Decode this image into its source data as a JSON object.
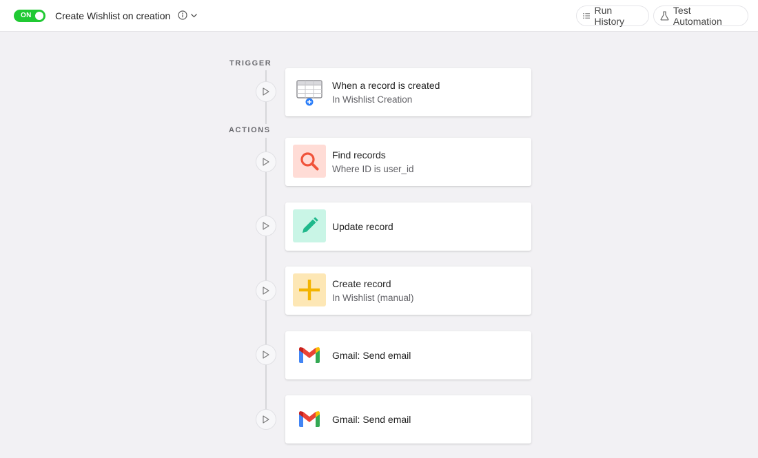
{
  "header": {
    "toggle_label": "ON",
    "title": "Create Wishlist on creation",
    "run_history_label": "Run History",
    "test_automation_label": "Test Automation",
    "toggle_color": "#20c933"
  },
  "sections": {
    "trigger_label": "TRIGGER",
    "actions_label": "ACTIONS"
  },
  "steps": [
    {
      "title": "When a record is created",
      "subtitle": "In Wishlist Creation",
      "icon": "table-add-icon"
    },
    {
      "title": "Find records",
      "subtitle": "Where ID is user_id",
      "icon": "search-icon",
      "icon_bg": "#ffdcd6",
      "icon_color": "#f0533a"
    },
    {
      "title": "Update record",
      "subtitle": "",
      "icon": "pencil-icon",
      "icon_bg": "#c9f5e6",
      "icon_color": "#1fb88b"
    },
    {
      "title": "Create record",
      "subtitle": "In Wishlist (manual)",
      "icon": "plus-icon",
      "icon_bg": "#fde7b5",
      "icon_color": "#f3b400"
    },
    {
      "title": "Gmail: Send email",
      "subtitle": "",
      "icon": "gmail-icon"
    },
    {
      "title": "Gmail: Send email",
      "subtitle": "",
      "icon": "gmail-icon"
    }
  ]
}
